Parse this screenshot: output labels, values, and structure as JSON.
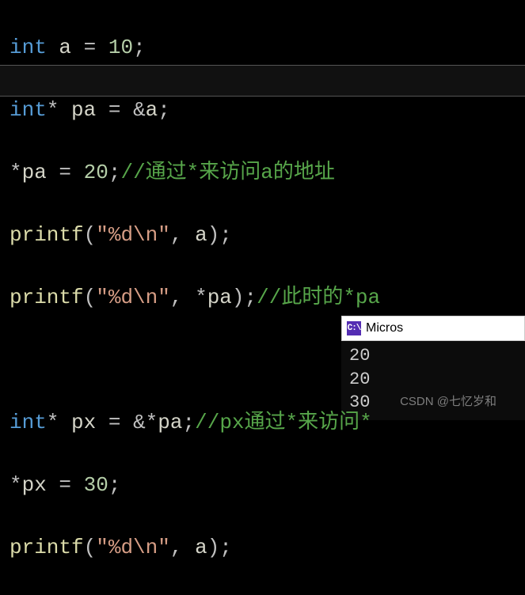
{
  "code": {
    "l1": {
      "kw": "int",
      "id": "a",
      "op1": " = ",
      "num": "10",
      "end": ";"
    },
    "l2": {
      "kw": "int",
      "star": "*",
      "id": "pa",
      "op1": " = ",
      "amp": "&",
      "id2": "a",
      "end": ";"
    },
    "l3": {
      "star": "*",
      "id": "pa",
      "op1": " = ",
      "num": "20",
      "end": ";",
      "com": "//通过*来访问a的地址"
    },
    "l4": {
      "fn": "printf",
      "lp": "(",
      "str": "\"%d\\n\"",
      "comma": ", ",
      "id": "a",
      "rp": ")",
      "end": ";"
    },
    "l5": {
      "fn": "printf",
      "lp": "(",
      "str": "\"%d\\n\"",
      "comma": ", ",
      "star": "*",
      "id": "pa",
      "rp": ")",
      "end": ";",
      "com": "//此时的*pa"
    },
    "l6": {
      "blank": " "
    },
    "l7": {
      "kw": "int",
      "star": "*",
      "id": "px",
      "op1": " = ",
      "amp": "&",
      "star2": "*",
      "id2": "pa",
      "end": ";",
      "com": "//px通过*来访问*"
    },
    "l8": {
      "star": "*",
      "id": "px",
      "op1": " = ",
      "num": "30",
      "end": ";"
    },
    "l9": {
      "fn": "printf",
      "lp": "(",
      "str": "\"%d\\n\"",
      "comma": ", ",
      "id": "a",
      "rp": ")",
      "end": ";"
    }
  },
  "output": {
    "title": "Micros",
    "lines": {
      "o1": "20",
      "o2": "20",
      "o3": "30"
    }
  },
  "watermark": "CSDN @七忆岁和"
}
